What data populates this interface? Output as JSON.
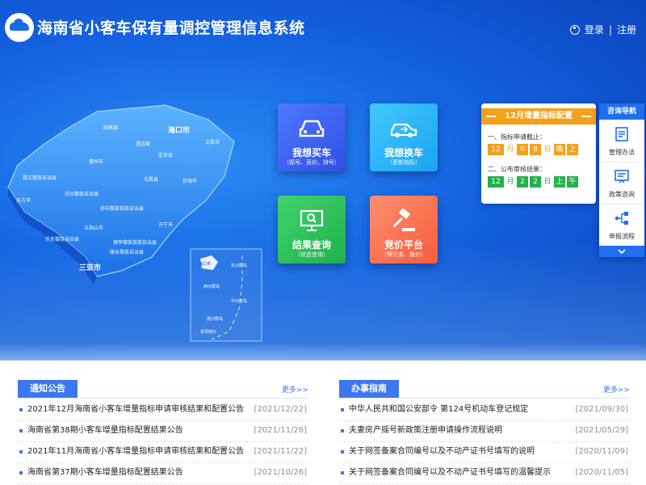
{
  "header": {
    "title": "海南省小客车保有量调控管理信息系统",
    "login": "登录",
    "separator": "|",
    "register": "注册"
  },
  "tiles": [
    {
      "title": "我想买车",
      "sub": "（摇号、竞价、排号）",
      "icon": "car-icon"
    },
    {
      "title": "我想换车",
      "sub": "（更新指标）",
      "icon": "car-swap-icon"
    },
    {
      "title": "结果查询",
      "sub": "（状态查询）",
      "icon": "monitor-search-icon"
    },
    {
      "title": "竞价平台",
      "sub": "（保证金、报价）",
      "icon": "gavel-icon"
    }
  ],
  "allocation": {
    "title": "12月增量指标配置",
    "step1_label": "一、指标申请截止：",
    "step1_date": [
      "12",
      "月",
      "0",
      "8",
      "日",
      "晚",
      "上"
    ],
    "step2_label": "二、公布审核结果：",
    "step2_date": [
      "12",
      "月",
      "2",
      "2",
      "日",
      "上",
      "午"
    ]
  },
  "side_nav": {
    "title": "咨询导航",
    "items": [
      {
        "label": "管理办法"
      },
      {
        "label": "政策咨询"
      },
      {
        "label": "申报流程"
      }
    ]
  },
  "map": {
    "cities": [
      "海口市",
      "三亚市",
      "临高县",
      "澄迈县",
      "儋州市",
      "定安县",
      "屯昌县",
      "琼海市",
      "昌江黎族自治县",
      "白沙黎族自治县",
      "东方市",
      "琼中黎族苗族自治县",
      "万宁市",
      "五指山市",
      "乐东黎族自治县",
      "保亭黎族苗族自治县",
      "陵水黎族自治县",
      "文昌市"
    ],
    "inset": [
      "海口市",
      "东沙群岛",
      "西沙群岛",
      "中沙群岛",
      "南沙群岛",
      "曾母暗沙"
    ]
  },
  "notices": {
    "title": "通知公告",
    "more": "更多>>",
    "items": [
      {
        "text": "2021年12月海南省小客车增量指标申请审核结果和配置公告",
        "date": "[2021/12/22]"
      },
      {
        "text": "海南省第38期小客车增量指标配置结果公告",
        "date": "[2021/11/26]"
      },
      {
        "text": "2021年11月海南省小客车增量指标申请审核结果和配置公告",
        "date": "[2021/11/22]"
      },
      {
        "text": "海南省第37期小客车增量指标配置结果公告",
        "date": "[2021/10/26]"
      }
    ]
  },
  "guide": {
    "title": "办事指南",
    "more": "更多>>",
    "items": [
      {
        "text": "中华人民共和国公安部令 第124号机动车登记规定",
        "date": "[2021/09/30]"
      },
      {
        "text": "夫妻房产摇号新政策注册申请操作流程说明",
        "date": "[2021/05/29]"
      },
      {
        "text": "关于网签备案合同编号以及不动产证书号填写的说明",
        "date": "[2020/11/09]"
      },
      {
        "text": "关于网签备案合同编号以及不动产证书号填写的温馨提示",
        "date": "[2020/11/05]"
      }
    ]
  },
  "colors": {
    "primary": "#1f6ff0",
    "orange": "#f5a01a",
    "green": "#22b24c"
  }
}
